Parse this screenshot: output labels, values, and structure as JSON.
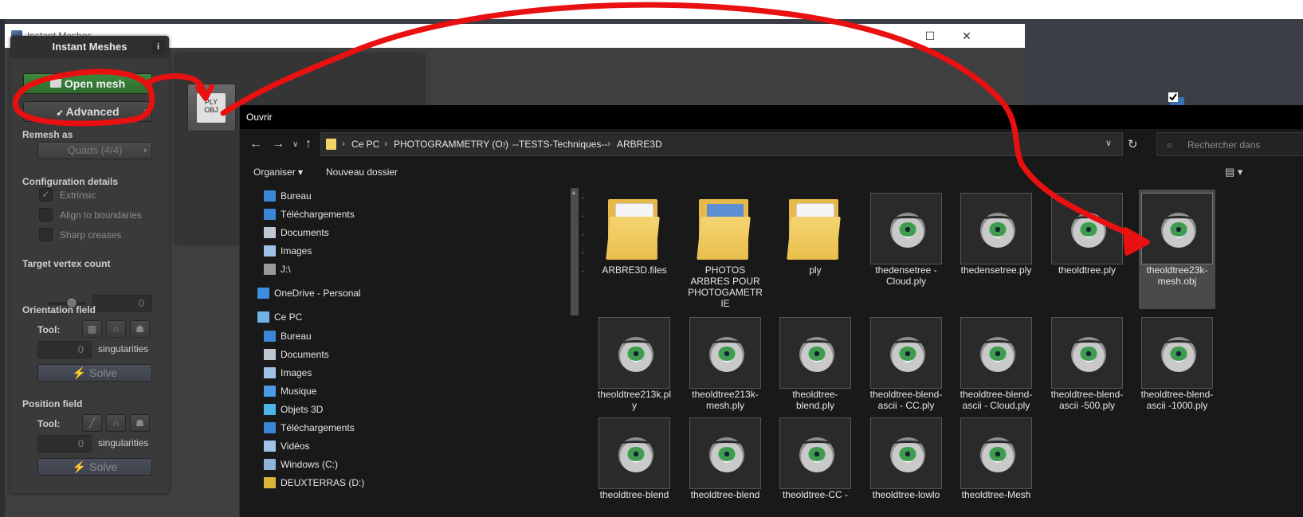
{
  "window": {
    "title": "Instant Meshes",
    "minimize_glyph": "—",
    "maximize_glyph": "☐",
    "close_glyph": "✕"
  },
  "panel": {
    "title": "Instant Meshes",
    "info_glyph": "i",
    "open_mesh_label": "Open mesh",
    "advanced_label": "Advanced",
    "chevron": "›",
    "remesh_as_title": "Remesh as",
    "remesh_value": "Quads (4/4)",
    "config_title": "Configuration details",
    "extrinsic_label": "Extrinsic",
    "align_label": "Align to boundaries",
    "sharp_label": "Sharp creases",
    "target_title": "Target vertex count",
    "target_value": "0",
    "orientation_title": "Orientation field",
    "tool_label": "Tool:",
    "orient_singularities_value": "0",
    "singularities_label": "singularities",
    "solve_label": "⚡ Solve",
    "position_title": "Position field",
    "position_singularities_value": "0"
  },
  "popup": {
    "ply_obj_label": "PLY\nOBJ"
  },
  "dialog": {
    "title": "Ouvrir",
    "breadcrumbs": [
      "Ce PC",
      "PHOTOGRAMMETRY (O:)",
      "--TESTS-Techniques--",
      "ARBRE3D"
    ],
    "crumb_sep": "›",
    "search_placeholder": "Rechercher dans",
    "organiser_label": "Organiser ▾",
    "nouveau_label": "Nouveau dossier",
    "quick_access": [
      {
        "label": "Bureau",
        "icon": "desktop-icon",
        "color": "#3b86d6"
      },
      {
        "label": "Téléchargements",
        "icon": "download-icon",
        "color": "#3b86d6"
      },
      {
        "label": "Documents",
        "icon": "documents-icon",
        "color": "#bfc7d3"
      },
      {
        "label": "Images",
        "icon": "images-icon",
        "color": "#9fc3e8"
      },
      {
        "label": "J:\\",
        "icon": "drive-icon",
        "color": "#9a9a9a"
      }
    ],
    "onedrive_label": "OneDrive - Personal",
    "thispc_label": "Ce PC",
    "thispc_items": [
      {
        "label": "Bureau",
        "icon": "desktop-icon",
        "color": "#3b86d6"
      },
      {
        "label": "Documents",
        "icon": "documents-icon",
        "color": "#bfc7d3"
      },
      {
        "label": "Images",
        "icon": "images-icon",
        "color": "#9fc3e8"
      },
      {
        "label": "Musique",
        "icon": "music-icon",
        "color": "#4c9be8"
      },
      {
        "label": "Objets 3D",
        "icon": "objects3d-icon",
        "color": "#4fb4e8"
      },
      {
        "label": "Téléchargements",
        "icon": "download-icon",
        "color": "#3b86d6"
      },
      {
        "label": "Vidéos",
        "icon": "videos-icon",
        "color": "#9fc3e8"
      },
      {
        "label": "Windows (C:)",
        "icon": "drive-icon",
        "color": "#8fb3d9"
      },
      {
        "label": "DEUXTERRAS (D:)",
        "icon": "drive-icon",
        "color": "#d9b43a"
      }
    ],
    "files": [
      {
        "name": "ARBRE3D.files",
        "kind": "folder-doc"
      },
      {
        "name": "PHOTOS ARBRES POUR PHOTOGAMETR IE",
        "kind": "folder-photo"
      },
      {
        "name": "ply",
        "kind": "folder-doc"
      },
      {
        "name": "thedensetree - Cloud.ply",
        "kind": "eye"
      },
      {
        "name": "thedensetree.ply",
        "kind": "eye"
      },
      {
        "name": "theoldtree.ply",
        "kind": "eye"
      },
      {
        "name": "theoldtree23k-mesh.obj",
        "kind": "eye",
        "selected": true
      },
      {
        "name": "theoldtree213k.ply",
        "kind": "eye"
      },
      {
        "name": "theoldtree213k-mesh.ply",
        "kind": "eye"
      },
      {
        "name": "theoldtree-blend.ply",
        "kind": "eye"
      },
      {
        "name": "theoldtree-blend-ascii - CC.ply",
        "kind": "eye"
      },
      {
        "name": "theoldtree-blend-ascii - Cloud.ply",
        "kind": "eye"
      },
      {
        "name": "theoldtree-blend-ascii -500.ply",
        "kind": "eye"
      },
      {
        "name": "theoldtree-blend-ascii -1000.ply",
        "kind": "eye"
      },
      {
        "name": "theoldtree-blend",
        "kind": "eye"
      },
      {
        "name": "theoldtree-blend",
        "kind": "eye"
      },
      {
        "name": "theoldtree-CC -",
        "kind": "eye"
      },
      {
        "name": "theoldtree-lowlo",
        "kind": "eye"
      },
      {
        "name": "theoldtree-Mesh",
        "kind": "eye"
      }
    ]
  },
  "colors": {
    "annotation": "#e81010",
    "open_mesh_green": "#2f7a2f"
  }
}
